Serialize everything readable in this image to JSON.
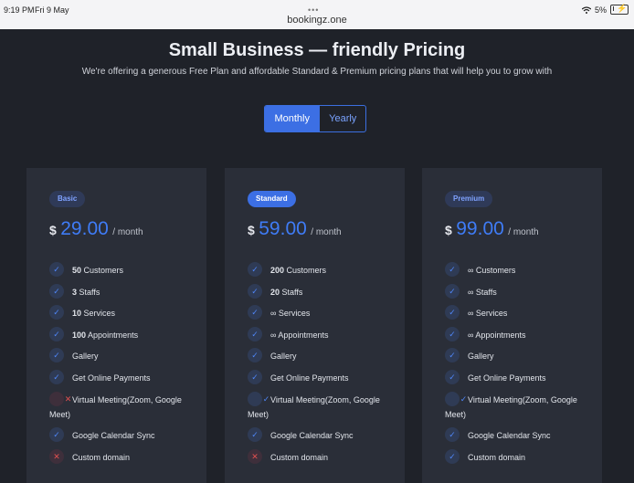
{
  "status": {
    "time": "9:19 PM",
    "date": "Fri 9 May",
    "url": "bookingz.one",
    "battery": "5%"
  },
  "header": {
    "title": "Small Business — friendly Pricing",
    "subtitle": "We're offering a generous Free Plan and affordable Standard & Premium pricing plans that will help you to grow with"
  },
  "billing_toggle": {
    "monthly": "Monthly",
    "yearly": "Yearly",
    "selected": "Monthly"
  },
  "colors": {
    "accent": "#3c6fe4",
    "price": "#3f7cf6",
    "cross": "#e05050"
  },
  "plans": [
    {
      "badge": "Basic",
      "currency": "$",
      "amount": "29.00",
      "period": "/ month",
      "features": [
        {
          "num": "50",
          "text": "Customers",
          "ok": true
        },
        {
          "num": "3",
          "text": "Staffs",
          "ok": true
        },
        {
          "num": "10",
          "text": "Services",
          "ok": true
        },
        {
          "num": "100",
          "text": "Appointments",
          "ok": true
        },
        {
          "num": "",
          "text": "Gallery",
          "ok": true
        },
        {
          "num": "",
          "text": "Get Online Payments",
          "ok": true
        },
        {
          "num": "",
          "text": "Virtual Meeting(Zoom, Google Meet)",
          "ok": false
        },
        {
          "num": "",
          "text": "Google Calendar Sync",
          "ok": true
        },
        {
          "num": "",
          "text": "Custom domain",
          "ok": false
        }
      ]
    },
    {
      "badge": "Standard",
      "currency": "$",
      "amount": "59.00",
      "period": "/ month",
      "features": [
        {
          "num": "200",
          "text": "Customers",
          "ok": true
        },
        {
          "num": "20",
          "text": "Staffs",
          "ok": true
        },
        {
          "num": "",
          "text": "∞ Services",
          "ok": true
        },
        {
          "num": "",
          "text": "∞ Appointments",
          "ok": true
        },
        {
          "num": "",
          "text": "Gallery",
          "ok": true
        },
        {
          "num": "",
          "text": "Get Online Payments",
          "ok": true
        },
        {
          "num": "",
          "text": "Virtual Meeting(Zoom, Google Meet)",
          "ok": true
        },
        {
          "num": "",
          "text": "Google Calendar Sync",
          "ok": true
        },
        {
          "num": "",
          "text": "Custom domain",
          "ok": false
        }
      ]
    },
    {
      "badge": "Premium",
      "currency": "$",
      "amount": "99.00",
      "period": "/ month",
      "features": [
        {
          "num": "",
          "text": "∞ Customers",
          "ok": true
        },
        {
          "num": "",
          "text": "∞ Staffs",
          "ok": true
        },
        {
          "num": "",
          "text": "∞ Services",
          "ok": true
        },
        {
          "num": "",
          "text": "∞ Appointments",
          "ok": true
        },
        {
          "num": "",
          "text": "Gallery",
          "ok": true
        },
        {
          "num": "",
          "text": "Get Online Payments",
          "ok": true
        },
        {
          "num": "",
          "text": "Virtual Meeting(Zoom, Google Meet)",
          "ok": true
        },
        {
          "num": "",
          "text": "Google Calendar Sync",
          "ok": true
        },
        {
          "num": "",
          "text": "Custom domain",
          "ok": true
        }
      ]
    }
  ]
}
